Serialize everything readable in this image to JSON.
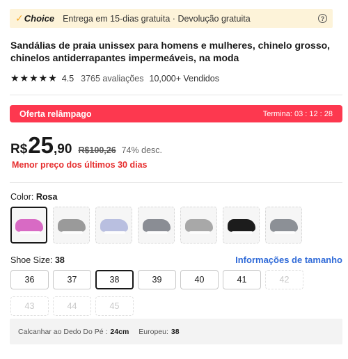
{
  "choice_bar": {
    "badge": "Choice",
    "text": "Entrega em 15-dias gratuita · Devolução gratuita",
    "help_icon": "question-circle-icon"
  },
  "product": {
    "title": "Sandálias de praia unissex para homens e mulheres, chinelo grosso, chinelos antiderrapantes impermeáveis, na moda",
    "stars": "★★★★★",
    "rating": "4.5",
    "reviews": "3765 avaliações",
    "sold": "10,000+ Vendidos"
  },
  "flash": {
    "label": "Oferta relâmpago",
    "timer": "Termina: 03 : 12 : 28",
    "color": "#fd384f"
  },
  "price": {
    "currency": "R$",
    "integer": "25",
    "decimal": ",90",
    "old": "R$100,26",
    "discount": "74% desc.",
    "lowest_note": "Menor preço dos últimos 30 dias"
  },
  "color": {
    "label": "Color:",
    "selected": "Rosa",
    "swatches": [
      {
        "color": "#d86ac4",
        "selected": true
      },
      {
        "color": "#9a9a9a",
        "selected": false
      },
      {
        "color": "#b9bfe0",
        "selected": false
      },
      {
        "color": "#8a8d94",
        "selected": false
      },
      {
        "color": "#a8a8a8",
        "selected": false
      },
      {
        "color": "#1c1c1c",
        "selected": false
      },
      {
        "color": "#8c9096",
        "selected": false
      }
    ]
  },
  "size": {
    "label": "Shoe Size:",
    "selected": "38",
    "guide_link": "Informações de tamanho",
    "options": [
      {
        "label": "36",
        "state": "normal"
      },
      {
        "label": "37",
        "state": "normal"
      },
      {
        "label": "38",
        "state": "selected"
      },
      {
        "label": "39",
        "state": "normal"
      },
      {
        "label": "40",
        "state": "normal"
      },
      {
        "label": "41",
        "state": "normal"
      },
      {
        "label": "42",
        "state": "disabled"
      },
      {
        "label": "43",
        "state": "disabled"
      },
      {
        "label": "44",
        "state": "disabled"
      },
      {
        "label": "45",
        "state": "disabled"
      }
    ]
  },
  "measure": {
    "heel_label": "Calcanhar ao Dedo Do Pé :",
    "heel_value": "24cm",
    "eu_label": "Europeu:",
    "eu_value": "38"
  }
}
